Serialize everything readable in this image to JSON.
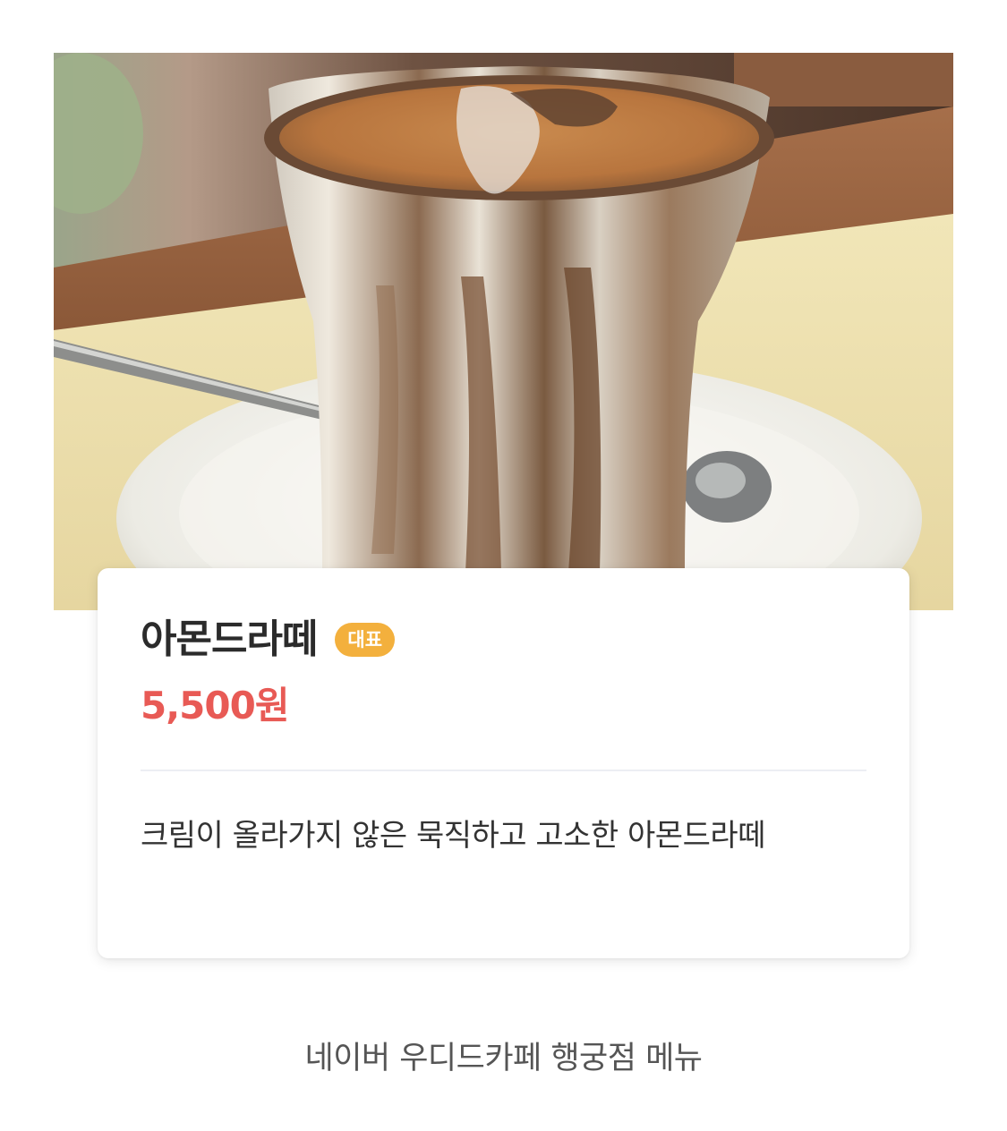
{
  "menu_item": {
    "name": "아몬드라떼",
    "badge": "대표",
    "price": "5,500원",
    "description": "크림이 올라가지 않은 묵직하고 고소한 아몬드라떼"
  },
  "footer": {
    "caption": "네이버 우디드카페 행궁점 메뉴"
  },
  "colors": {
    "price": "#e85a55",
    "badge": "#f3b03d",
    "divider": "#eceef3"
  }
}
